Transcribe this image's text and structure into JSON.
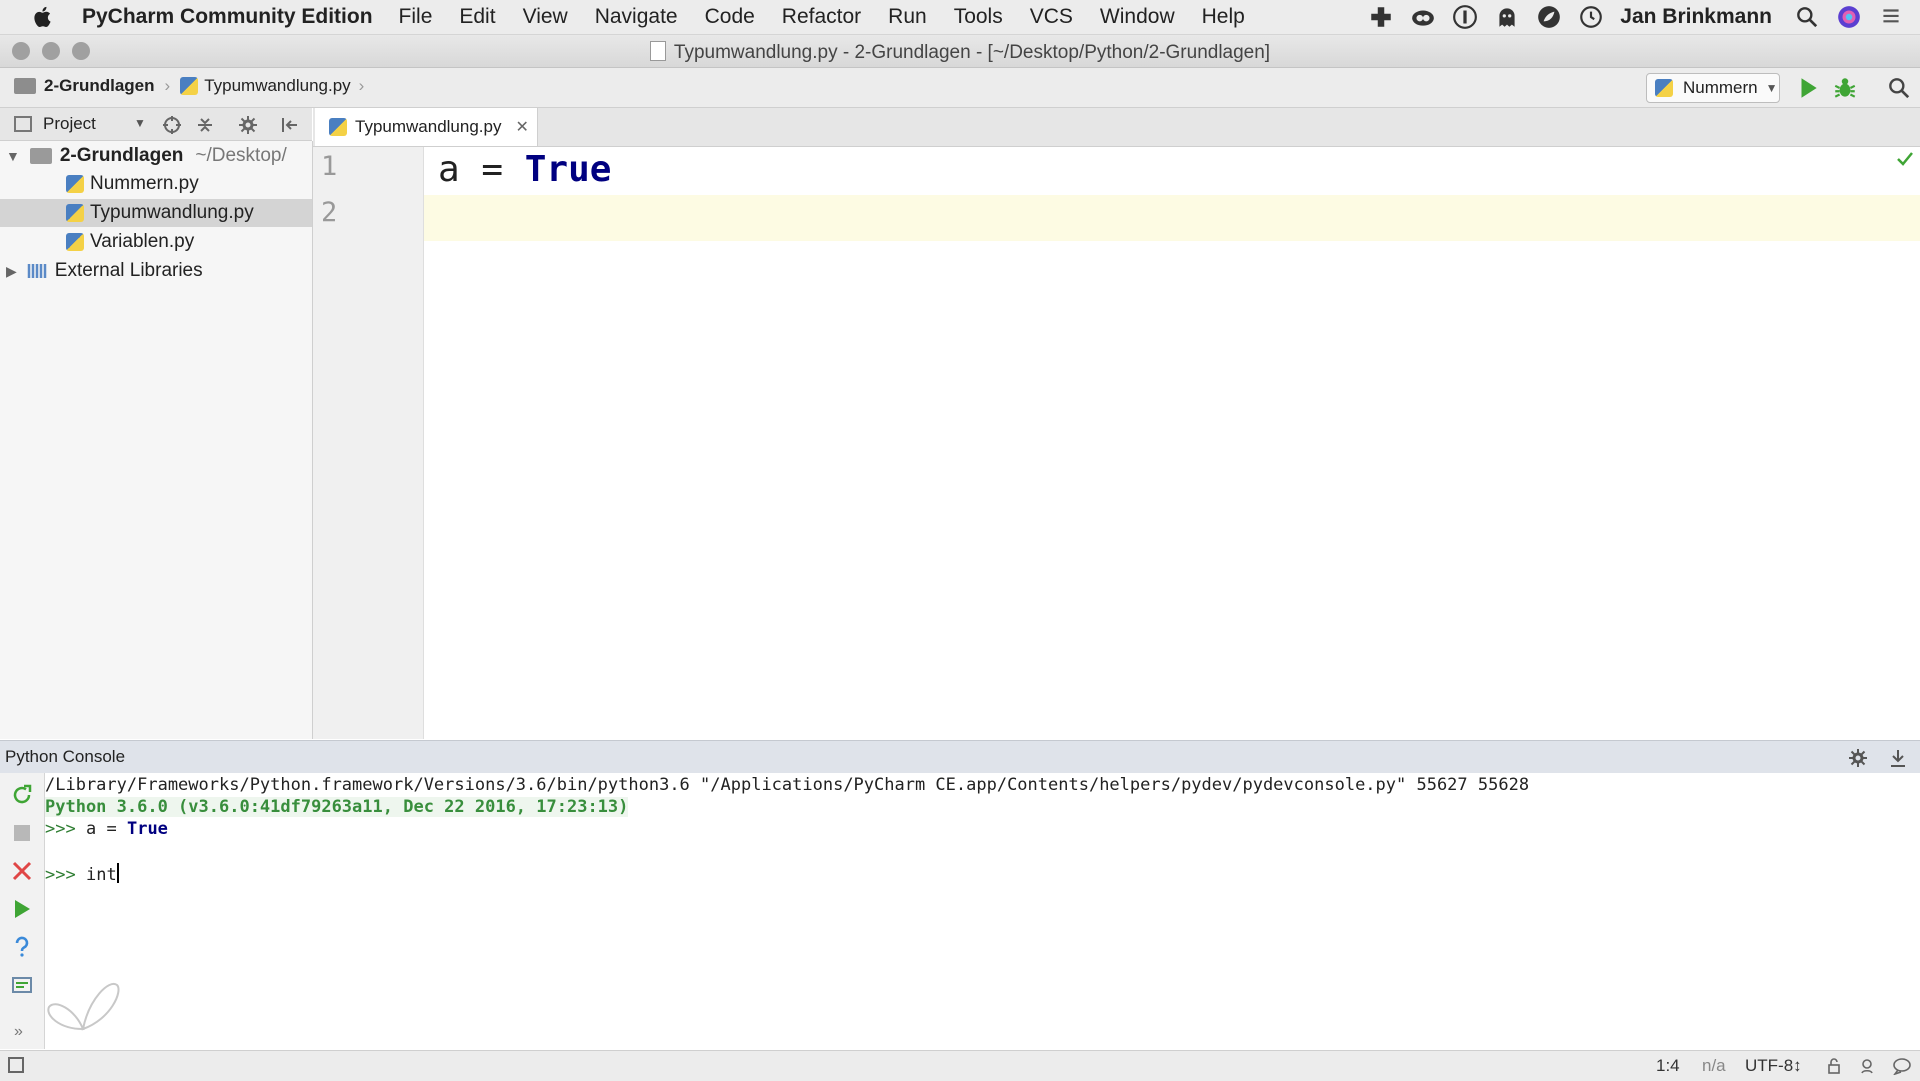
{
  "menubar": {
    "app_name": "PyCharm Community Edition",
    "items": [
      "File",
      "Edit",
      "View",
      "Navigate",
      "Code",
      "Refactor",
      "Run",
      "Tools",
      "VCS",
      "Window",
      "Help"
    ],
    "user": "Jan Brinkmann"
  },
  "window": {
    "title": "Typumwandlung.py - 2-Grundlagen - [~/Desktop/Python/2-Grundlagen]"
  },
  "navbar": {
    "breadcrumbs": [
      "2-Grundlagen",
      "Typumwandlung.py"
    ],
    "run_config": "Nummern"
  },
  "project": {
    "view_label": "Project",
    "root": {
      "name": "2-Grundlagen",
      "path": "~/Desktop/"
    },
    "files": [
      "Nummern.py",
      "Typumwandlung.py",
      "Variablen.py"
    ],
    "selected_file": "Typumwandlung.py",
    "external": "External Libraries"
  },
  "editor": {
    "tab_label": "Typumwandlung.py",
    "line_numbers": [
      "1",
      "2"
    ],
    "line1": {
      "var": "a",
      "op": "=",
      "value": "True"
    },
    "line2": ""
  },
  "console": {
    "title": "Python Console",
    "lines": [
      "/Library/Frameworks/Python.framework/Versions/3.6/bin/python3.6 \"/Applications/PyCharm CE.app/Contents/helpers/pydev/pydevconsole.py\" 55627 55628",
      "Python 3.6.0 (v3.6.0:41df79263a11, Dec 22 2016, 17:23:13)"
    ],
    "prompt": ">>>",
    "history_input": {
      "var": "a",
      "op": "=",
      "value": "True"
    },
    "current_input": "int"
  },
  "statusbar": {
    "position": "1:4",
    "vcs": "n/a",
    "encoding": "UTF-8↕"
  },
  "colors": {
    "run_green": "#3fa535",
    "keyword": "#000080",
    "stop_red": "#e04646"
  }
}
